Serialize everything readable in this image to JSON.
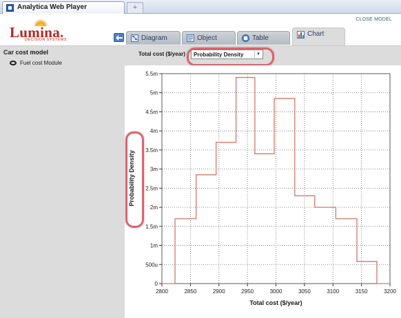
{
  "browser": {
    "tab_title": "Analytica Web Player",
    "new_tab_symbol": "+"
  },
  "header": {
    "logo_text": "Lumina.",
    "logo_subtitle": "DECISION SYSTEMS",
    "close_label": "CLOSE MODEL"
  },
  "tabs": [
    {
      "label": "Diagram",
      "icon": "diagram-icon"
    },
    {
      "label": "Object",
      "icon": "object-icon"
    },
    {
      "label": "Table",
      "icon": "table-icon"
    },
    {
      "label": "Chart",
      "icon": "chart-icon",
      "active": true
    }
  ],
  "left_panel": {
    "title": "Car cost model",
    "items": [
      {
        "label": "Fuel cost Module",
        "icon": "module-node-icon"
      }
    ]
  },
  "view": {
    "selector_label": "Total cost ($/year)",
    "selector_value": "Probability Density",
    "selector_arrow": "▼"
  },
  "colors": {
    "series": "#d07868",
    "highlight": "#d9646f",
    "grid": "#666666"
  },
  "chart_data": {
    "type": "line",
    "step": true,
    "xlabel": "Total cost ($/year)",
    "ylabel": "Probability Density",
    "xlim": [
      2800,
      3200
    ],
    "ylim": [
      0,
      0.0055
    ],
    "x_ticks": [
      2800,
      2850,
      2900,
      2950,
      3000,
      3050,
      3100,
      3150,
      3200
    ],
    "y_ticks": [
      {
        "value": 0,
        "label": "0"
      },
      {
        "value": 0.0005,
        "label": "500u"
      },
      {
        "value": 0.001,
        "label": "1m"
      },
      {
        "value": 0.0015,
        "label": "1.5m"
      },
      {
        "value": 0.002,
        "label": "2m"
      },
      {
        "value": 0.0025,
        "label": "2.5m"
      },
      {
        "value": 0.003,
        "label": "3m"
      },
      {
        "value": 0.0035,
        "label": "3.5m"
      },
      {
        "value": 0.004,
        "label": "4m"
      },
      {
        "value": 0.0045,
        "label": "4.5m"
      },
      {
        "value": 0.005,
        "label": "5m"
      },
      {
        "value": 0.0055,
        "label": "5.5m"
      }
    ],
    "grid": true,
    "bins": [
      {
        "x0": 2800,
        "x1": 2823,
        "y": 0
      },
      {
        "x0": 2823,
        "x1": 2860,
        "y": 0.0017
      },
      {
        "x0": 2860,
        "x1": 2895,
        "y": 0.00285
      },
      {
        "x0": 2895,
        "x1": 2930,
        "y": 0.0037
      },
      {
        "x0": 2930,
        "x1": 2963,
        "y": 0.0054
      },
      {
        "x0": 2963,
        "x1": 2997,
        "y": 0.0034
      },
      {
        "x0": 2997,
        "x1": 3033,
        "y": 0.00485
      },
      {
        "x0": 3033,
        "x1": 3068,
        "y": 0.0023
      },
      {
        "x0": 3068,
        "x1": 3105,
        "y": 0.002
      },
      {
        "x0": 3105,
        "x1": 3142,
        "y": 0.0017
      },
      {
        "x0": 3142,
        "x1": 3177,
        "y": 0.00058
      },
      {
        "x0": 3177,
        "x1": 3200,
        "y": 0
      }
    ]
  }
}
